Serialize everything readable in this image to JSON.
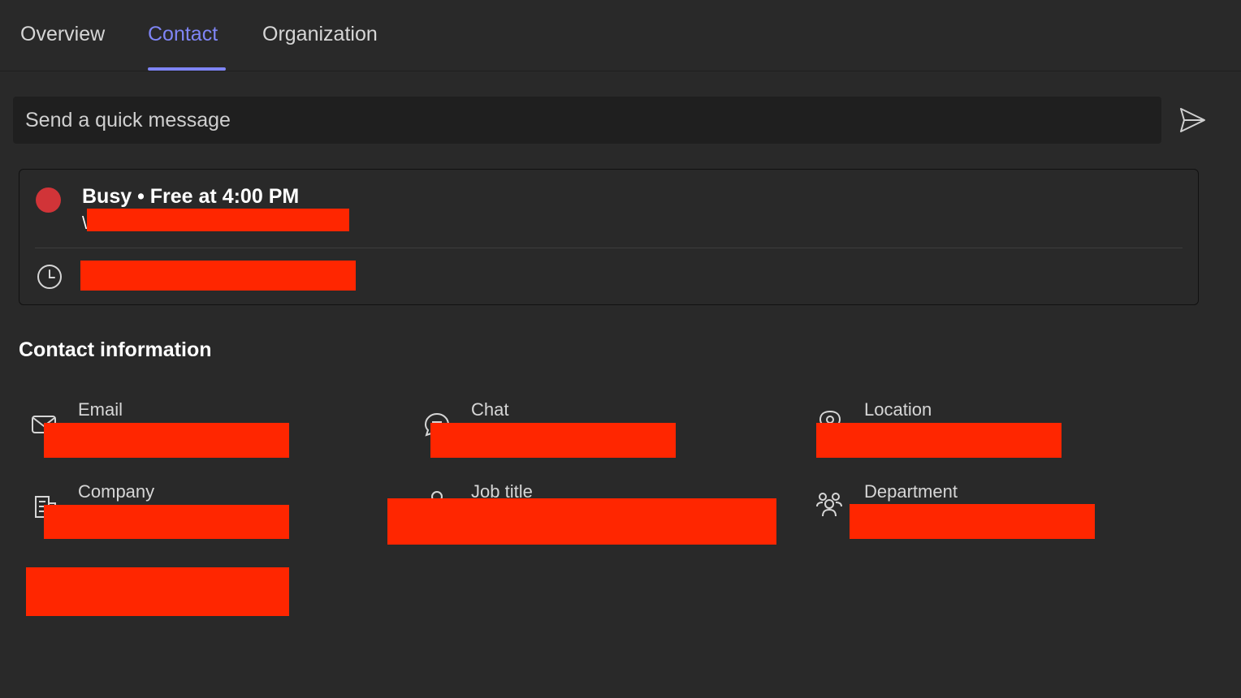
{
  "tabs": [
    {
      "label": "Overview",
      "active": false
    },
    {
      "label": "Contact",
      "active": true
    },
    {
      "label": "Organization",
      "active": false
    }
  ],
  "quick_message": {
    "placeholder": "Send a quick message"
  },
  "presence": {
    "status": "Busy • Free at 4:00 PM",
    "substatus_visible": "\\"
  },
  "contact_info": {
    "title": "Contact information",
    "fields": {
      "email": {
        "label": "Email",
        "icon": "mail-icon"
      },
      "chat": {
        "label": "Chat",
        "icon": "chat-icon"
      },
      "location": {
        "label": "Location",
        "icon": "location-icon"
      },
      "company": {
        "label": "Company",
        "icon": "building-icon"
      },
      "job_title": {
        "label": "Job title",
        "icon": "person-icon"
      },
      "department": {
        "label": "Department",
        "icon": "people-icon"
      }
    }
  },
  "colors": {
    "accent": "#7f85f5",
    "busy": "#d13438",
    "redaction": "#ff2600",
    "background": "#292929"
  }
}
